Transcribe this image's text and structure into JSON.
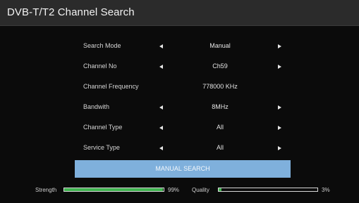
{
  "header": {
    "title": "DVB-T/T2 Channel Search"
  },
  "settings": [
    {
      "label": "Search Mode",
      "value": "Manual",
      "has_arrows": true
    },
    {
      "label": "Channel No",
      "value": "Ch59",
      "has_arrows": true
    },
    {
      "label": "Channel Frequency",
      "value": "778000 KHz",
      "has_arrows": false
    },
    {
      "label": "Bandwith",
      "value": "8MHz",
      "has_arrows": true
    },
    {
      "label": "Channel Type",
      "value": "All",
      "has_arrows": true
    },
    {
      "label": "Service Type",
      "value": "All",
      "has_arrows": true
    }
  ],
  "search_button": {
    "label": "MANUAL SEARCH"
  },
  "meters": {
    "strength": {
      "label": "Strength",
      "percent_text": "99%",
      "level": 0.99
    },
    "quality": {
      "label": "Quality",
      "percent_text": "3%",
      "level": 0.03
    }
  },
  "icons": {
    "left_arrow": "triangle-left-icon",
    "right_arrow": "triangle-right-icon"
  },
  "colors": {
    "accent_button": "#7fb0dc",
    "meter_fill": "#3fb34f",
    "title_bar": "#2b2b2b",
    "background": "#0b0b0b"
  }
}
